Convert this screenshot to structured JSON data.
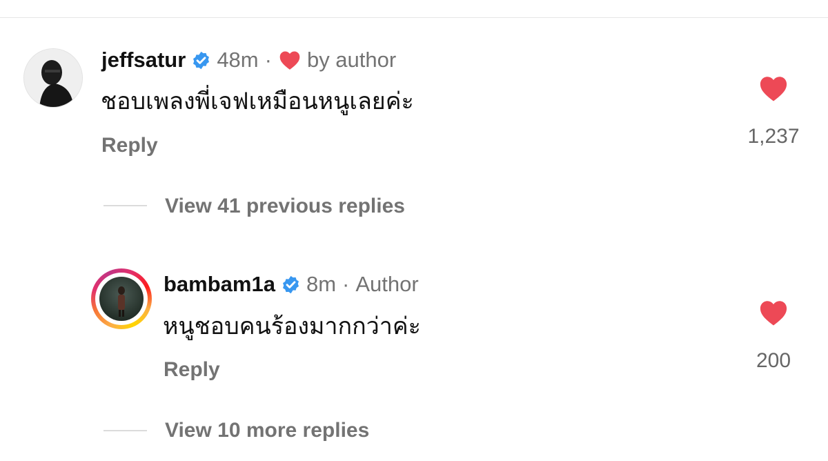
{
  "comments": [
    {
      "username": "jeffsatur",
      "time": "48m",
      "separator": "·",
      "tag": "by author",
      "text": "ชอบเพลงพี่เจฟเหมือนหนูเลยค่ะ",
      "reply_label": "Reply",
      "like_count": "1,237"
    },
    {
      "username": "bambam1a",
      "time": "8m",
      "separator": "·",
      "tag": "Author",
      "text": "หนูชอบคนร้องมากกว่าค่ะ",
      "reply_label": "Reply",
      "like_count": "200"
    }
  ],
  "threads": {
    "previous_replies": "View 41 previous replies",
    "more_replies": "View 10 more replies"
  },
  "icons": {
    "verified": "verified-badge-icon",
    "heart": "heart-icon"
  },
  "colors": {
    "verified_blue": "#3897f0",
    "heart_red": "#ed4956",
    "muted_text": "#737373"
  }
}
